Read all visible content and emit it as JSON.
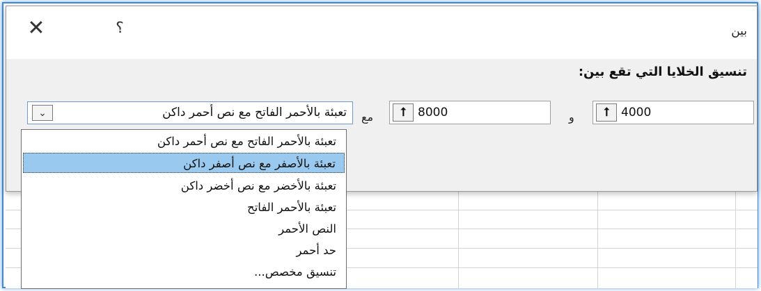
{
  "dialog": {
    "title": "بين",
    "close_glyph": "✕",
    "help_glyph": "؟",
    "prompt": "تنسيق الخلايا التي تقع بين:"
  },
  "range": {
    "low_value": "4000",
    "and_label": "و",
    "high_value": "8000",
    "with_label": "مع",
    "collapse_glyph": "⭡"
  },
  "format": {
    "selected": "تعبئة بالأحمر الفاتح مع نص أحمر داكن",
    "options": [
      "تعبئة بالأحمر الفاتح مع نص أحمر داكن",
      "تعبئة بالأصفر مع نص أصفر داكن",
      "تعبئة بالأخضر مع نص أخضر داكن",
      "تعبئة بالأحمر الفاتح",
      "النص الأحمر",
      "حد أحمر",
      "تنسيق مخصص..."
    ],
    "highlighted_index": 1
  }
}
